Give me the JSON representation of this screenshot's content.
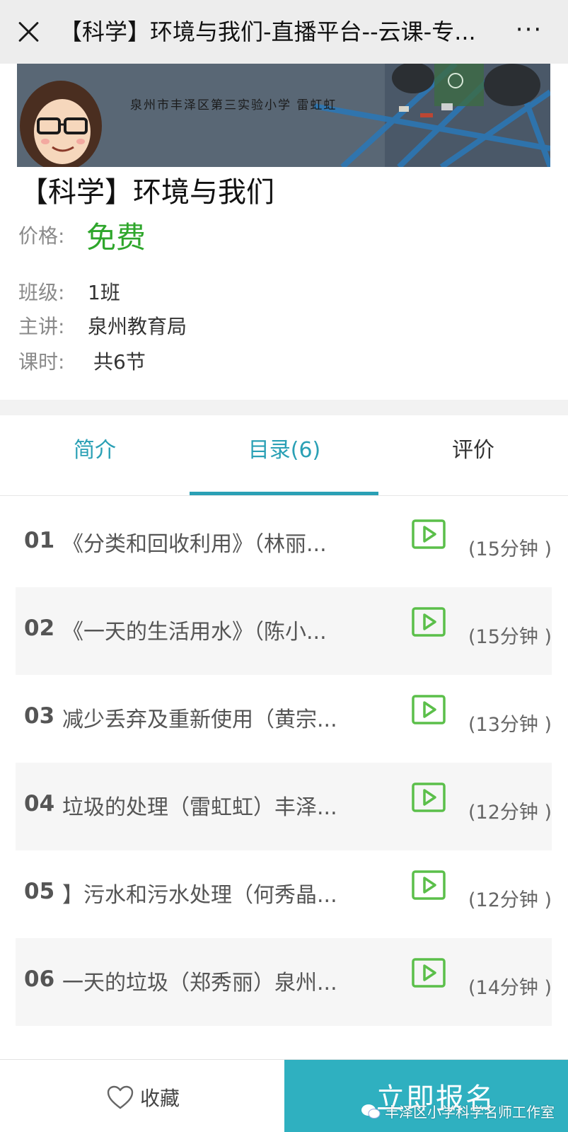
{
  "header": {
    "title": "【科学】环境与我们-直播平台--云课-专...",
    "more_label": "···"
  },
  "banner": {
    "caption": "泉州市丰泽区第三实验小学  雷虹虹"
  },
  "course": {
    "title": "【科学】环境与我们",
    "price_label": "价格:",
    "price_value": "免费",
    "class_label": "班级:",
    "class_value": "1班",
    "lecturer_label": "主讲:",
    "lecturer_value": "泉州教育局",
    "lessons_label": "课时:",
    "lessons_value": "共6节"
  },
  "tabs": [
    {
      "label": "简介"
    },
    {
      "label": "目录(6)",
      "active": true
    },
    {
      "label": "评价"
    }
  ],
  "lessons": [
    {
      "num": "01",
      "title": "《分类和回收利用》（林丽...",
      "duration": "(15分钟 )"
    },
    {
      "num": "02",
      "title": "《一天的生活用水》（陈小...",
      "duration": "(15分钟 )"
    },
    {
      "num": "03",
      "title": "减少丢弃及重新使用（黄宗...",
      "duration": "(13分钟 )"
    },
    {
      "num": "04",
      "title": "垃圾的处理（雷虹虹）丰泽...",
      "duration": "(12分钟 )"
    },
    {
      "num": "05",
      "title": "】污水和污水处理（何秀晶...",
      "duration": "(12分钟 )"
    },
    {
      "num": "06",
      "title": "一天的垃圾（郑秀丽）泉州...",
      "duration": "(14分钟 )"
    }
  ],
  "footer": {
    "favorite_label": "收藏",
    "enroll_label": "立即报名",
    "watermark_text": "丰泽区小学科学名师工作室"
  },
  "colors": {
    "accent": "#2aa0b5",
    "price_green": "#2ea62b",
    "play_icon_green": "#5bbf4a",
    "enroll_bg": "#2fb0c0"
  }
}
